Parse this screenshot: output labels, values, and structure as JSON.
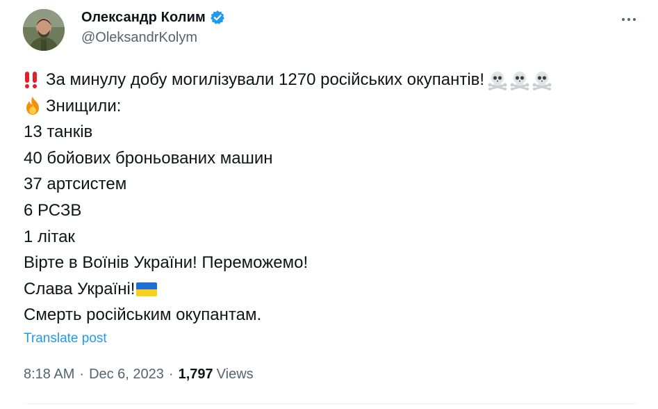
{
  "author": {
    "display_name": "Олександр Колим",
    "handle": "@OleksandrKolym",
    "verified_color": "#1d9bf0"
  },
  "post": {
    "lines": [
      "За минулу добу могилізували 1270 російських окупантів!",
      "Знищили:",
      "13 танків",
      "40 бойових броньованих машин",
      "37 артсистем",
      "6 РСЗВ",
      "1 літак",
      "Вірте в Воїнів України! Переможемо!",
      "Слава Україні!",
      "Смерть російським окупантам."
    ],
    "emojis": {
      "line0_prefix": "double-exclamation-icon",
      "line0_suffix": [
        "skull-crossbones-icon",
        "skull-crossbones-icon",
        "skull-crossbones-icon"
      ],
      "line1_prefix": "fire-icon",
      "line8_suffix": "ukraine-flag-icon"
    }
  },
  "translate_label": "Translate post",
  "meta": {
    "time": "8:18 AM",
    "separator": "·",
    "date": "Dec 6, 2023",
    "views_count": "1,797",
    "views_label": "Views"
  },
  "colors": {
    "text": "#0f1419",
    "secondary": "#536471",
    "link": "#1d9bf0",
    "divider": "#eff3f4"
  }
}
